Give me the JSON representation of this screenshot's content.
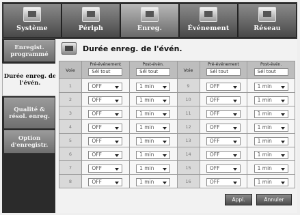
{
  "tabs": [
    {
      "label": "Système",
      "icon": "monitor-icon"
    },
    {
      "label": "Périph",
      "icon": "camera-icon"
    },
    {
      "label": "Enreg.",
      "icon": "rec-icon"
    },
    {
      "label": "Événement",
      "icon": "event-icon"
    },
    {
      "label": "Réseau",
      "icon": "network-icon"
    }
  ],
  "sidebar": {
    "items": [
      {
        "label": "Enregist. programmé"
      },
      {
        "label": "Durée enreg. de l'évén."
      },
      {
        "label": "Qualité & résol. enreg."
      },
      {
        "label": "Option d'enregistr."
      }
    ]
  },
  "page": {
    "title": "Durée enreg. de l'évén.",
    "icon": "recording-duration-icon"
  },
  "table": {
    "headers": {
      "voie": "Voie",
      "pre": "Pré-événement",
      "post": "Post-évén.",
      "select_all": "Sél tout"
    },
    "left": [
      {
        "ch": "1",
        "pre": "OFF",
        "post": "1 min"
      },
      {
        "ch": "2",
        "pre": "OFF",
        "post": "1 min"
      },
      {
        "ch": "3",
        "pre": "OFF",
        "post": "1 min"
      },
      {
        "ch": "4",
        "pre": "OFF",
        "post": "1 min"
      },
      {
        "ch": "5",
        "pre": "OFF",
        "post": "1 min"
      },
      {
        "ch": "6",
        "pre": "OFF",
        "post": "1 min"
      },
      {
        "ch": "7",
        "pre": "OFF",
        "post": "1 min"
      },
      {
        "ch": "8",
        "pre": "OFF",
        "post": "1 min"
      }
    ],
    "right": [
      {
        "ch": "9",
        "pre": "OFF",
        "post": "1 min"
      },
      {
        "ch": "10",
        "pre": "OFF",
        "post": "1 min"
      },
      {
        "ch": "11",
        "pre": "OFF",
        "post": "1 min"
      },
      {
        "ch": "12",
        "pre": "OFF",
        "post": "1 min"
      },
      {
        "ch": "13",
        "pre": "OFF",
        "post": "1 min"
      },
      {
        "ch": "14",
        "pre": "OFF",
        "post": "1 min"
      },
      {
        "ch": "15",
        "pre": "OFF",
        "post": "1 min"
      },
      {
        "ch": "16",
        "pre": "OFF",
        "post": "1 min"
      }
    ]
  },
  "buttons": {
    "apply": "Appl.",
    "cancel": "Annuler"
  }
}
